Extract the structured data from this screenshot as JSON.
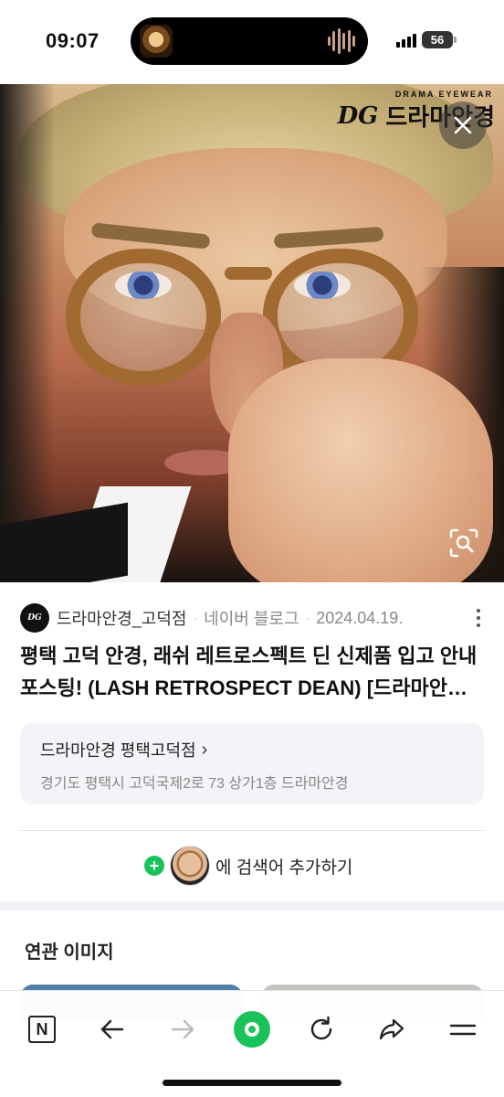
{
  "status_bar": {
    "time": "09:07",
    "battery": "56",
    "signal_bars": 4
  },
  "hero": {
    "brand_small": "DRAMA EYEWEAR",
    "brand_name": "드라마안경",
    "brand_mark": "DG",
    "close_icon": "close-icon",
    "lens_icon": "image-search-icon"
  },
  "result": {
    "source_logo": "DG",
    "source_name": "드라마안경_고덕점",
    "source_type": "네이버 블로그",
    "source_date": "2024.04.19.",
    "separator": "·",
    "title": "평택 고덕 안경, 래쉬 레트로스펙트 딘 신제품 입고 안내 포스팅! (LASH RETROSPECT DEAN) [드라마안경 고덕점]",
    "place": {
      "name": "드라마안경 평택고덕점",
      "chevron": "›",
      "address": "경기도 평택시 고덕국제2로 73 상가1층 드라마안경"
    },
    "add_search": {
      "plus": "+",
      "text": "에 검색어 추가하기"
    }
  },
  "related": {
    "title": "연관 이미지"
  },
  "toolbar": {
    "naver_label": "N",
    "items": [
      "naver-home-icon",
      "back-icon",
      "forward-icon",
      "green-home-icon",
      "reload-icon",
      "share-icon",
      "menu-icon"
    ]
  },
  "colors": {
    "accent_green": "#19c35a",
    "card_bg": "#f3f4f7"
  }
}
